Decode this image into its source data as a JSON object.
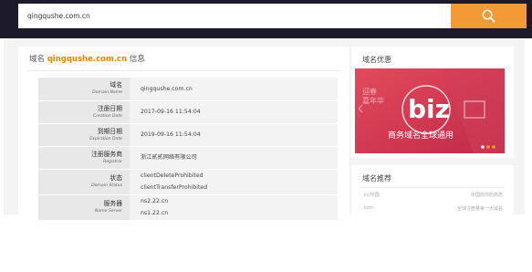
{
  "search": {
    "query": "qingqushe.com.cn"
  },
  "domain_info": {
    "title_prefix": "域名",
    "domain": "qingqushe.com.cn",
    "title_suffix": "信息",
    "rows": [
      {
        "label_cn": "域名",
        "label_en": "Domain Name",
        "values": [
          "qingqushe.com.cn"
        ]
      },
      {
        "label_cn": "注册日期",
        "label_en": "Creation Date",
        "values": [
          "2017-09-16 11:54:04"
        ]
      },
      {
        "label_cn": "到期日期",
        "label_en": "Expiration Date",
        "values": [
          "2019-09-16 11:54:04"
        ]
      },
      {
        "label_cn": "注册服务商",
        "label_en": "Registrar",
        "values": [
          "浙江贰贰网络有限公司"
        ]
      },
      {
        "label_cn": "状态",
        "label_en": "Domain Status",
        "values": [
          "clientDeleteProhibited",
          "clientTransferProhibited"
        ]
      },
      {
        "label_cn": "服务器",
        "label_en": "Name Server",
        "values": [
          "ns2.22.cn",
          "ns1.22.cn"
        ]
      }
    ]
  },
  "promo": {
    "title": "域名优惠",
    "banner": {
      "text_biz": "biz",
      "text_cn_left": "迎春",
      "text_cn_left2": "嘉年华",
      "tagline": "商务域名全球通用"
    }
  },
  "recommend": {
    "title": "域名推荐",
    "items": [
      {
        "name": ".cc/中国",
        "desc": "中国商你的商态"
      },
      {
        "name": ".com",
        "desc": "全球注册量第一大域名"
      }
    ]
  },
  "colors": {
    "topbar": "#1d1b2b",
    "accent": "#f39a37",
    "domain_orange": "#f08300",
    "banner_bg": "#d23a54"
  }
}
